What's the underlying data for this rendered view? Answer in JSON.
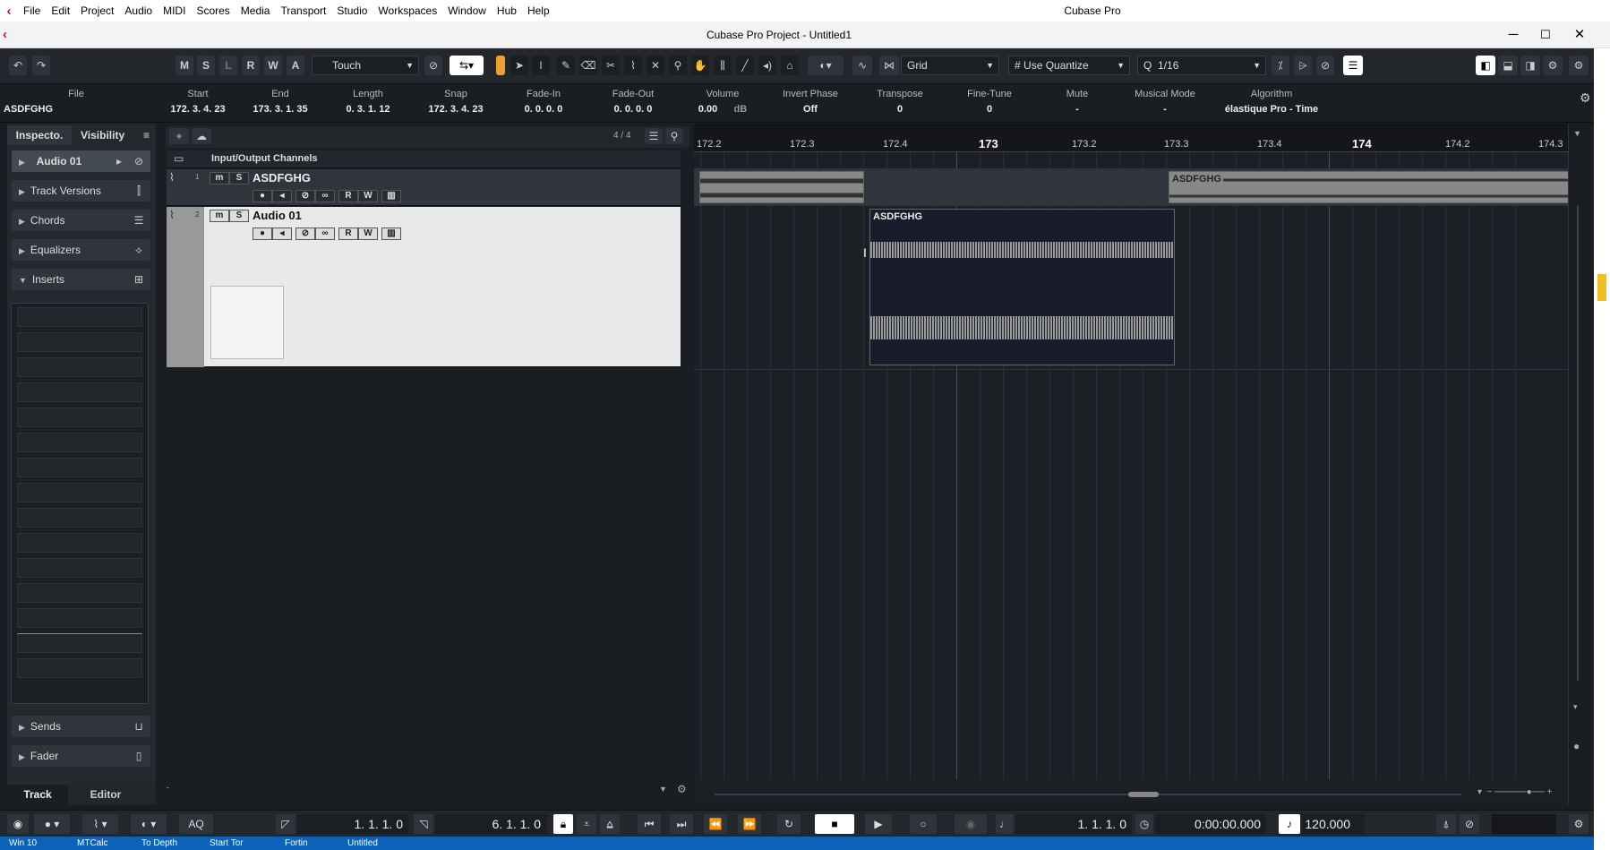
{
  "menu": {
    "items": [
      "File",
      "Edit",
      "Project",
      "Audio",
      "MIDI",
      "Scores",
      "Media",
      "Transport",
      "Studio",
      "Workspaces",
      "Window",
      "Hub",
      "Help"
    ],
    "app_title": "Cubase Pro"
  },
  "window": {
    "title": "Cubase Pro Project - Untitled1",
    "minimize": "─",
    "maximize": "☐",
    "close": "✕"
  },
  "toolbar": {
    "buttons": {
      "mute": "M",
      "solo": "S",
      "listen": "L",
      "read": "R",
      "write": "W",
      "auto": "A"
    },
    "automation_mode": "Touch",
    "snap_type": "Grid",
    "grid_type": "Use Quantize",
    "quantize": "1/16"
  },
  "infoline": {
    "file_label": "File",
    "file_value": "ASDFGHG",
    "fields": [
      {
        "label": "Start",
        "value": "172. 3. 4. 23"
      },
      {
        "label": "End",
        "value": "173. 3. 1. 35"
      },
      {
        "label": "Length",
        "value": "0. 3. 1. 12"
      },
      {
        "label": "Snap",
        "value": "172. 3. 4. 23"
      },
      {
        "label": "Fade-In",
        "value": "0. 0. 0. 0"
      },
      {
        "label": "Fade-Out",
        "value": "0. 0. 0. 0"
      },
      {
        "label": "Volume",
        "value": "0.00",
        "unit": "dB"
      },
      {
        "label": "Invert Phase",
        "value": "Off"
      },
      {
        "label": "Transpose",
        "value": "0"
      },
      {
        "label": "Fine-Tune",
        "value": "0"
      },
      {
        "label": "Mute",
        "value": "-"
      },
      {
        "label": "Musical Mode",
        "value": "-"
      },
      {
        "label": "Algorithm",
        "value": "élastique Pro - Time"
      }
    ]
  },
  "inspector": {
    "tabs": [
      "Inspecto.",
      "Visibility"
    ],
    "track_name": "Audio 01",
    "sections": [
      "Track Versions",
      "Chords",
      "Equalizers",
      "Inserts"
    ],
    "bottom_sections": [
      "Sends",
      "Fader"
    ]
  },
  "bottom_tabs": [
    "Track",
    "Editor"
  ],
  "tracklist": {
    "count": "4 / 4",
    "folder_name": "Input/Output Channels",
    "tracks": [
      {
        "num": "1",
        "name": "ASDFGHG"
      },
      {
        "num": "2",
        "name": "Audio 01"
      }
    ],
    "btn_m": "m",
    "btn_s": "S",
    "btn_r": "R",
    "btn_w": "W"
  },
  "ruler": {
    "labels": [
      "172.2",
      "172.3",
      "172.4",
      "173",
      "173.2",
      "173.3",
      "173.4",
      "174",
      "174.2",
      "174.3"
    ]
  },
  "events": {
    "track1_b": "ASDFGHG",
    "track2": "ASDFGHG"
  },
  "transport": {
    "aq": "AQ",
    "left_locator": "1. 1. 1.   0",
    "right_locator": "6. 1. 1.   0",
    "position": "1. 1. 1.   0",
    "time": "0:00:00.000",
    "tempo": "120.000"
  },
  "statusbar": [
    "Win 10",
    "MTCalc",
    "To Depth",
    "Start Tor",
    "Fortin",
    "Untitled"
  ],
  "colors": {
    "accent": "#f0a030",
    "brand": "#c8102e",
    "background": "#1a1d21",
    "status": "#0b62b8"
  }
}
